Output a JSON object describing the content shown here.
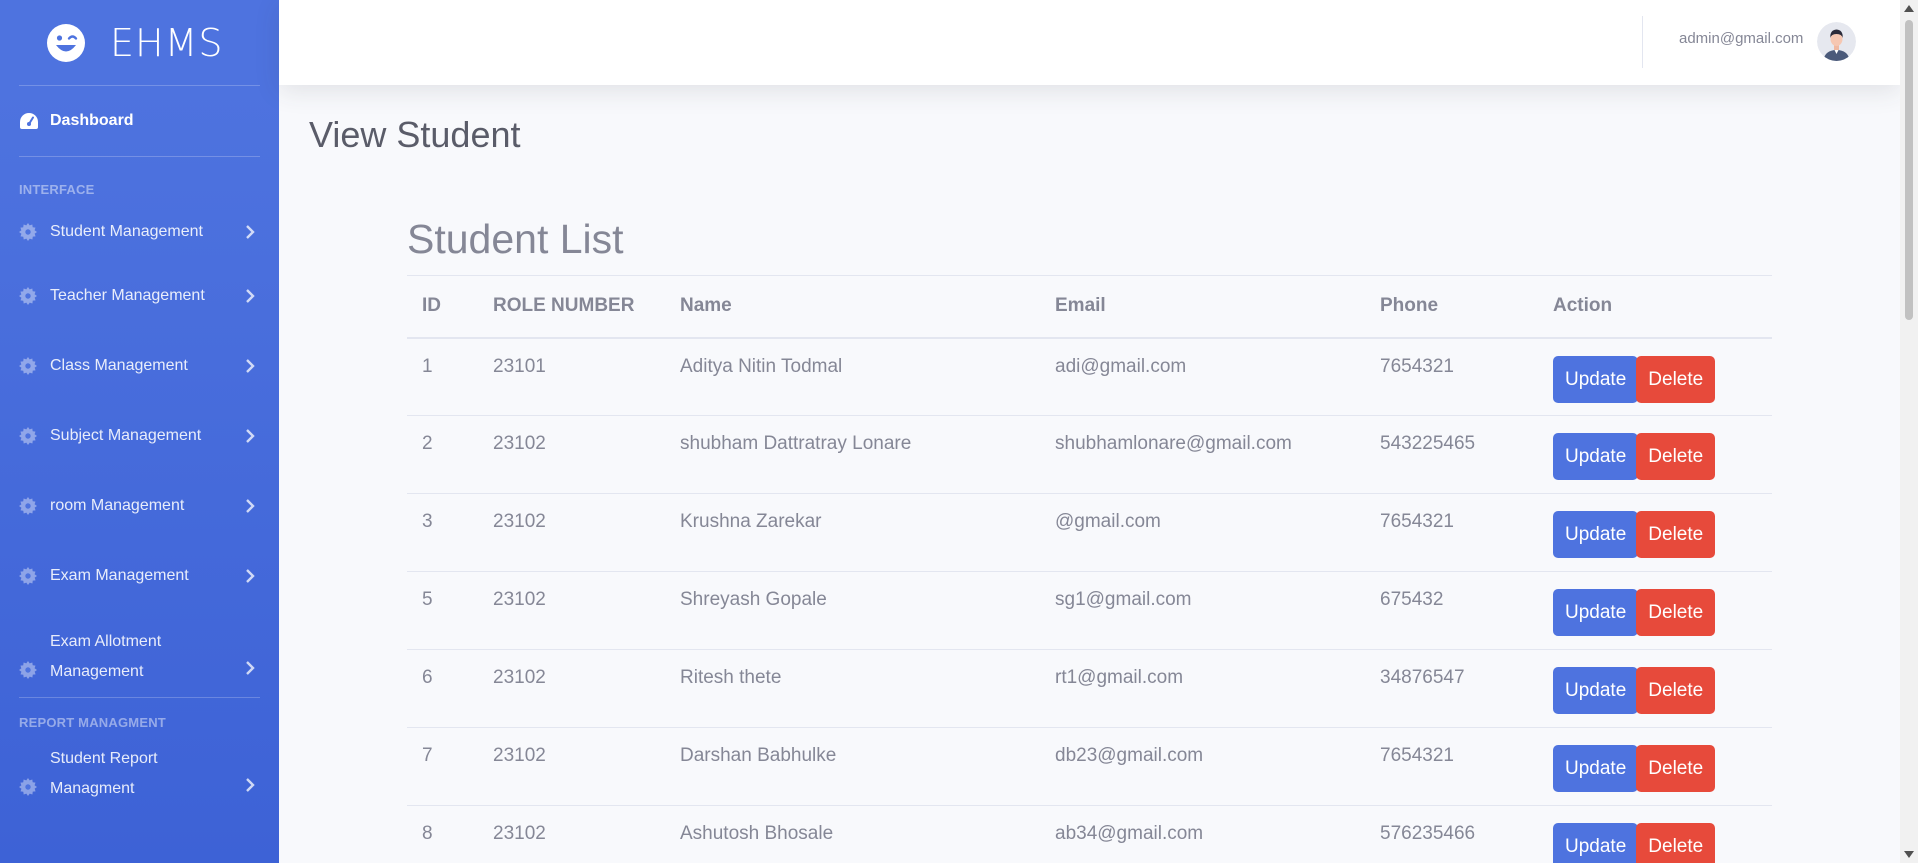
{
  "brand": {
    "name": "EHMS",
    "logo_icon": "grin-wink-icon"
  },
  "sidebar": {
    "dashboard_label": "Dashboard",
    "interface_heading": "INTERFACE",
    "items": [
      {
        "label": "Student Management"
      },
      {
        "label": "Teacher Management"
      },
      {
        "label": "Class Management"
      },
      {
        "label": "Subject Management"
      },
      {
        "label": "room Management"
      },
      {
        "label": "Exam Management"
      },
      {
        "label": "Exam Allotment Management"
      }
    ],
    "report_heading": "REPORT MANAGMENT",
    "report_items": [
      {
        "label": "Student Report Managment"
      }
    ]
  },
  "topbar": {
    "user_email": "admin@gmail.com"
  },
  "page": {
    "title": "View Student",
    "list_title": "Student List"
  },
  "table": {
    "headers": [
      "ID",
      "ROLE NUMBER",
      "Name",
      "Email",
      "Phone",
      "Action"
    ],
    "update_label": "Update",
    "delete_label": "Delete",
    "rows": [
      {
        "id": "1",
        "role": "23101",
        "name": "Aditya Nitin Todmal",
        "email": "adi@gmail.com",
        "phone": "7654321"
      },
      {
        "id": "2",
        "role": "23102",
        "name": "shubham Dattratray Lonare",
        "email": "shubhamlonare@gmail.com",
        "phone": "543225465"
      },
      {
        "id": "3",
        "role": "23102",
        "name": "Krushna Zarekar",
        "email": "@gmail.com",
        "phone": "7654321"
      },
      {
        "id": "5",
        "role": "23102",
        "name": "Shreyash Gopale",
        "email": "sg1@gmail.com",
        "phone": "675432"
      },
      {
        "id": "6",
        "role": "23102",
        "name": "Ritesh thete",
        "email": "rt1@gmail.com",
        "phone": "34876547"
      },
      {
        "id": "7",
        "role": "23102",
        "name": "Darshan Babhulke",
        "email": "db23@gmail.com",
        "phone": "7654321"
      },
      {
        "id": "8",
        "role": "23102",
        "name": "Ashutosh Bhosale",
        "email": "ab34@gmail.com",
        "phone": "576235466"
      }
    ]
  },
  "colors": {
    "primary": "#4e73df",
    "danger": "#e74a3b",
    "text": "#858796"
  }
}
